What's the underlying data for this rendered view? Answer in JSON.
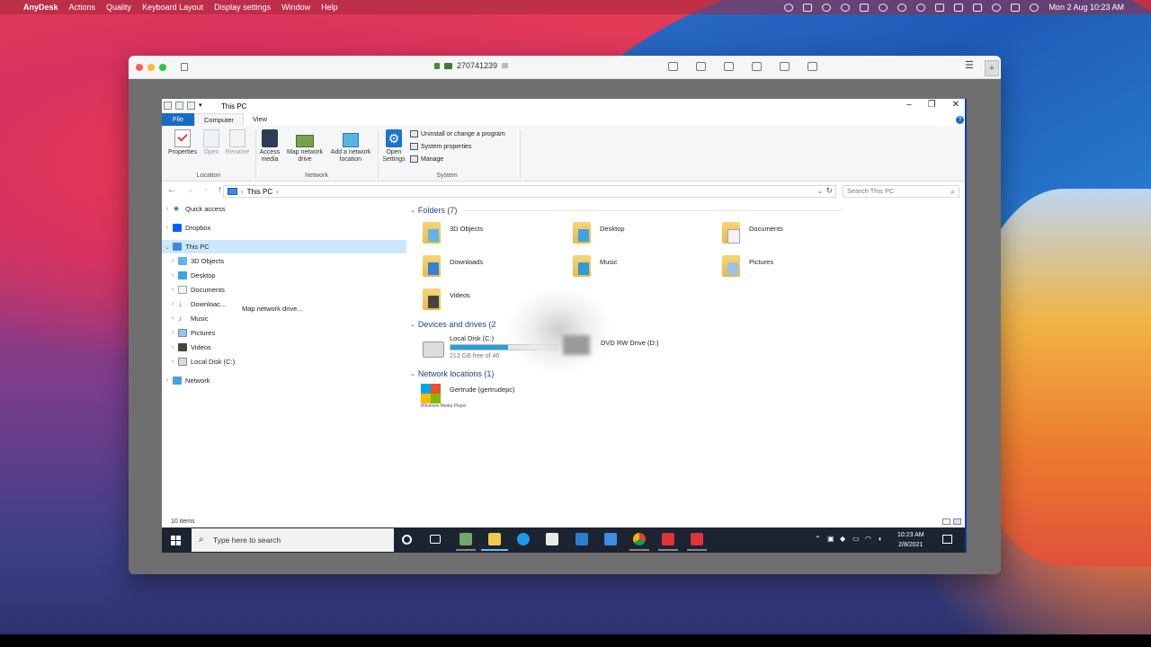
{
  "mac_menubar": {
    "app_name": "AnyDesk",
    "items": [
      "Actions",
      "Quality",
      "Keyboard Layout",
      "Display settings",
      "Window",
      "Help"
    ],
    "clock": "Mon 2 Aug  10:23 AM"
  },
  "anydesk": {
    "address": "270741239"
  },
  "explorer": {
    "title": "This PC",
    "tabs": {
      "file": "File",
      "computer": "Computer",
      "view": "View"
    },
    "ribbon": {
      "properties": "Properties",
      "open": "Open",
      "rename": "Rename",
      "access_media_1": "Access",
      "access_media_2": "media",
      "map_drive_1": "Map network",
      "map_drive_2": "drive",
      "add_location_1": "Add a network",
      "add_location_2": "location",
      "open_settings_1": "Open",
      "open_settings_2": "Settings",
      "uninstall": "Uninstall or change a program",
      "system_properties": "System properties",
      "manage": "Manage",
      "group_location": "Location",
      "group_network": "Network",
      "group_system": "System"
    },
    "address_bar": {
      "path": "This PC"
    },
    "search_placeholder": "Search This PC",
    "nav": {
      "quick_access": "Quick access",
      "dropbox": "Dropbox",
      "this_pc": "This PC",
      "objects3d": "3D Objects",
      "desktop": "Desktop",
      "documents": "Documents",
      "downloads": "Downloac...",
      "music": "Music",
      "pictures": "Pictures",
      "videos": "Videos",
      "local_disk": "Local Disk (C:)",
      "network": "Network"
    },
    "tooltip": "Map network drive...",
    "content": {
      "folders_header": "Folders (7)",
      "folders": [
        "3D Objects",
        "Desktop",
        "Documents",
        "Downloads",
        "Music",
        "Pictures",
        "Videos"
      ],
      "devices_header": "Devices and drives (2",
      "drive_c": {
        "label": "Local Disk (C:)",
        "free": "213 GB free of 46",
        "used_fraction": 0.54
      },
      "drive_d": {
        "label": "DVD RW Drive (D:)"
      },
      "network_header": "Network locations (1)",
      "network_item": "Gertrude (gertrudepc)",
      "wmp_caption": "Windows Media Player"
    },
    "status": "10 items"
  },
  "taskbar": {
    "search_placeholder": "Type here to search",
    "time": "10:23 AM",
    "date": "2/8/2021"
  }
}
